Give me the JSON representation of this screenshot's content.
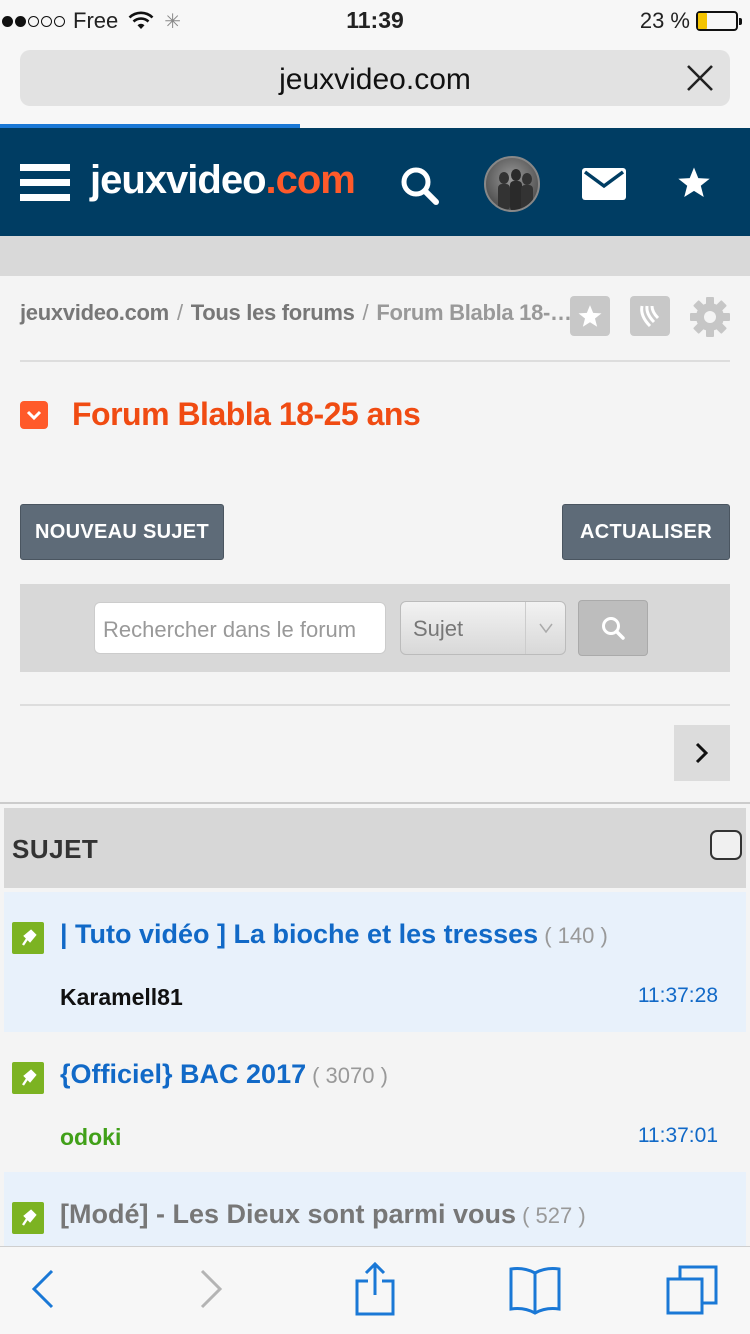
{
  "status_bar": {
    "carrier": "Free",
    "time": "11:39",
    "battery_percent_text": "23 %",
    "battery_level": 0.23,
    "signal_bars": 2
  },
  "browser": {
    "url": "jeuxvideo.com",
    "load_progress": 0.4
  },
  "site_header": {
    "logo_part1": "jeuxvideo",
    "logo_part2": ".com",
    "accent_color": "#ff5a2a",
    "background_color": "#003d63"
  },
  "breadcrumb": {
    "items": [
      "jeuxvideo.com",
      "Tous les forums",
      "Forum Blabla 18-…"
    ],
    "separator": "/"
  },
  "forum": {
    "title": "Forum Blabla 18-25 ans"
  },
  "actions": {
    "new_topic": "NOUVEAU SUJET",
    "refresh": "ACTUALISER"
  },
  "search": {
    "placeholder": "Rechercher dans le forum",
    "select_value": "Sujet"
  },
  "topics_table": {
    "header": "SUJET",
    "rows": [
      {
        "title": "| Tuto vidéo ] La bioche et les tresses",
        "count": "( 140 )",
        "author": "Karamell81",
        "time": "11:37:28"
      },
      {
        "title": "{Officiel} BAC 2017",
        "count": "( 3070 )",
        "author": "odoki",
        "time": "11:37:01"
      },
      {
        "title": "[Modé] - Les Dieux sont parmi vous",
        "count": "( 527 )",
        "author": "",
        "time": ""
      }
    ]
  },
  "icons": {
    "close": "close-icon",
    "menu": "hamburger-icon",
    "search": "search-icon",
    "mail": "mail-icon",
    "star": "star-icon",
    "gear": "gear-icon",
    "pin": "pin-icon",
    "back": "chevron-left-icon",
    "forward": "chevron-right-icon",
    "share": "share-icon",
    "bookmarks": "book-icon",
    "tabs": "tabs-icon"
  }
}
